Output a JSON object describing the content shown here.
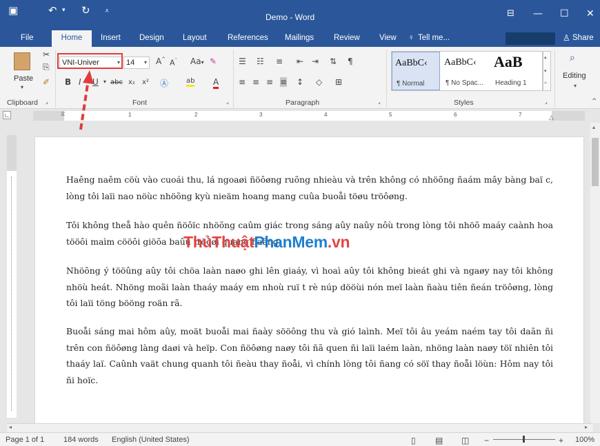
{
  "window": {
    "title": "Demo - Word"
  },
  "menu": {
    "file": "File",
    "home": "Home",
    "insert": "Insert",
    "design": "Design",
    "layout": "Layout",
    "references": "References",
    "mailings": "Mailings",
    "review": "Review",
    "view": "View",
    "tell_me": "Tell me...",
    "share": "Share"
  },
  "ribbon": {
    "paste": "Paste",
    "font_name": "VNI-Univer",
    "font_size": "14",
    "clipboard_label": "Clipboard",
    "font_label": "Font",
    "paragraph_label": "Paragraph",
    "styles_label": "Styles",
    "editing": "Editing",
    "styles": [
      {
        "sample": "AaBbC‹",
        "name": "¶ Normal"
      },
      {
        "sample": "AaBbC‹",
        "name": "¶ No Spac..."
      },
      {
        "sample": "AaB",
        "name": "Heading 1"
      }
    ]
  },
  "ruler": {
    "numbers": [
      "1",
      "2",
      "3",
      "4",
      "5",
      "6",
      "7"
    ]
  },
  "document": {
    "paragraphs": [
      "Haêng naêm cöù vào cuoái thu, lá ngoaøi ñöôøng ruõng nhieàu và trên không có nhöõng ñaám mây bàng baï c, lòng tôi laïi nao nöùc nhöõng kyù nieäm hoang mang cuûa buoåi töøu tröôøng.",
      "Tôi không theå hào quên ñöôïc nhöõng caûm giác trong sáng aûy naûy nôù trong lòng tôi nhöõ maáy caành hoa tööôi maìm cööôi giöõa baûu tröôøi quang ñaãng.",
      "Nhöõng ý tööûng aûy tôi chöa laàn naøo ghi lên giaáy, vì hoaì aûy tôi không bieát ghi và ngaøy nay tôi không nhöù heát. Nhöng moãi laàn thaáy maáy em nhoù ruï t rè núp dööùi nón meï laàn ñaàu tiên ñeán tröôøng, lòng tôi laïi töng bööng roän rã.",
      "Buoåi sáng mai hôm aûy, moät buoåi mai ñaày sööông thu và gió laình. Meï tôi âu yeám naém tay tôi daãn ñi trên con ñöôøng làng daøi và heïp. Con ñöôøng naøy tôi ñã quen ñi laïi laém laàn, nhöng laàn naøy töï nhiên tôi thaáy laï. Caûnh vaät chung quanh tôi ñeàu thay ñoåi, vì chính lòng tôi ñang có söï thay ñoåi löùn: Hôm nay tôi ñi hoïc."
    ]
  },
  "watermark": {
    "part1": "ThủThuật",
    "part2": "PhanMem",
    "part3": ".vn"
  },
  "status": {
    "page": "Page 1 of 1",
    "words": "184 words",
    "language": "English (United States)",
    "zoom": "100%"
  }
}
